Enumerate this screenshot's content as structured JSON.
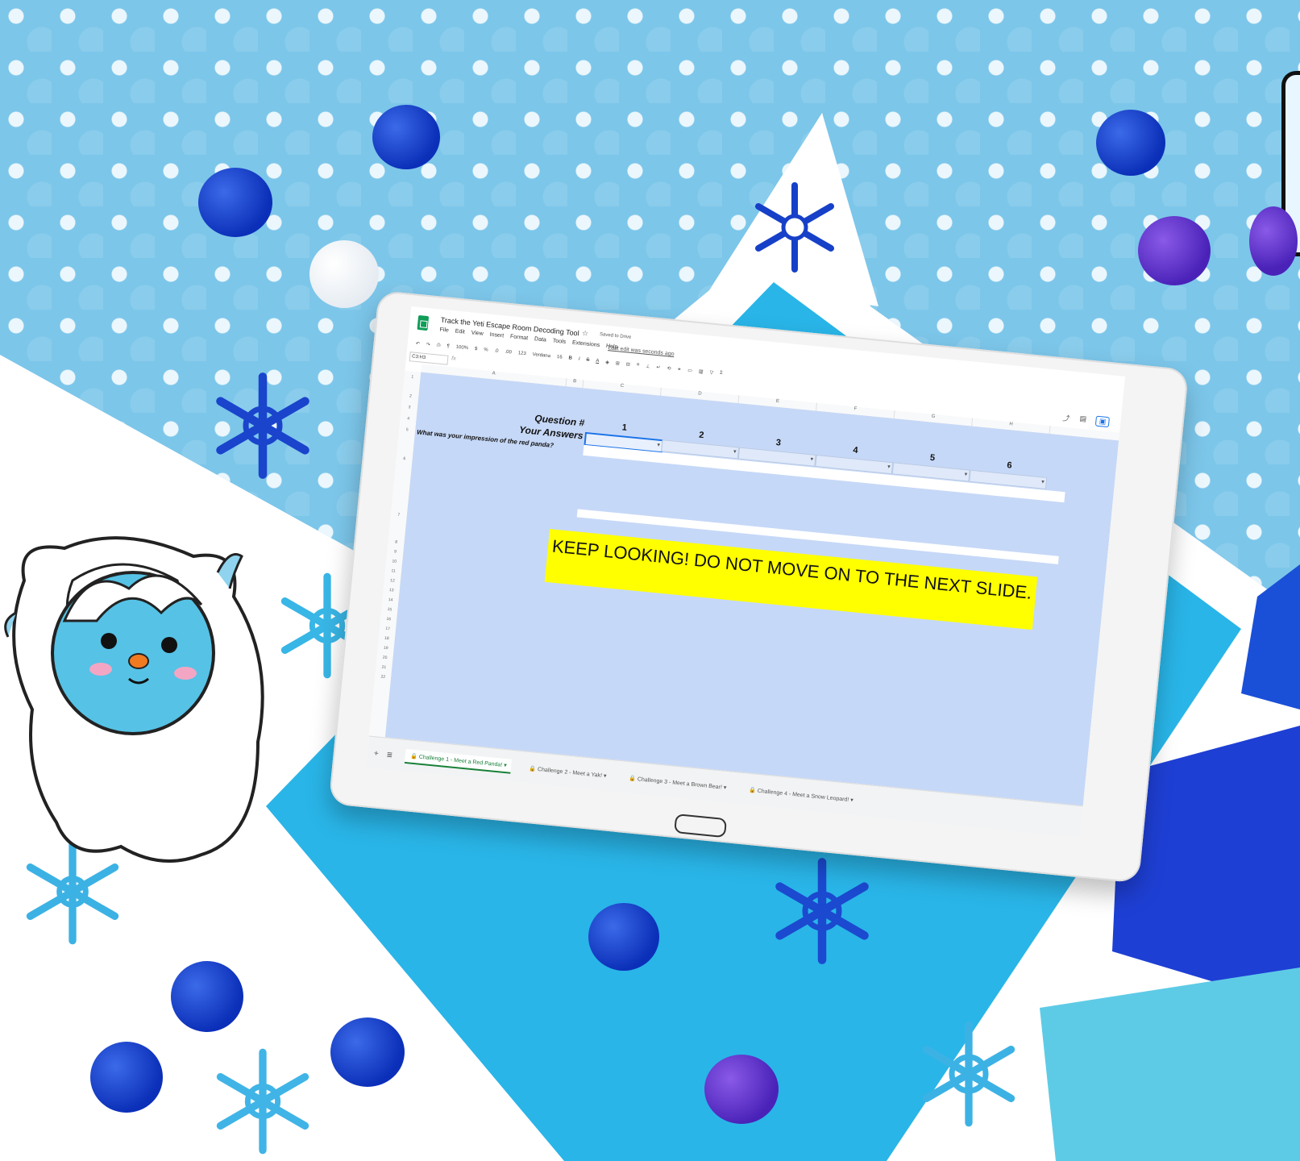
{
  "sheet": {
    "title": "Track the Yeti Escape Room Decoding Tool",
    "saved_status": "Saved to Drive",
    "last_edit": "Last edit was seconds ago",
    "menu": [
      "File",
      "Edit",
      "View",
      "Insert",
      "Format",
      "Data",
      "Tools",
      "Extensions",
      "Help"
    ],
    "toolbar": {
      "zoom": "100%",
      "currency": "$",
      "percent": "%",
      "decrease_decimal": ".0",
      "increase_decimal": ".00",
      "number_format": "123",
      "font": "Verdana",
      "font_size": "16",
      "bold": "B",
      "italic": "I",
      "strike": "S",
      "text_color": "A",
      "functions": "Σ"
    },
    "name_box": "C3:H3",
    "fx": "fx",
    "columns": [
      "A",
      "B",
      "C",
      "D",
      "E",
      "F",
      "G",
      "H"
    ],
    "rows": [
      "1",
      "2",
      "3",
      "4",
      "5",
      "6",
      "7",
      "8",
      "9",
      "10",
      "11",
      "12",
      "13",
      "14",
      "15",
      "16",
      "17",
      "18",
      "19",
      "20",
      "21",
      "22"
    ],
    "question_label": "Question #",
    "answers_label": "Your Answers",
    "question_numbers": [
      "1",
      "2",
      "3",
      "4",
      "5",
      "6"
    ],
    "impression_label": "What was your impression of the red panda?",
    "banner": "KEEP LOOKING! DO NOT MOVE ON TO THE NEXT SLIDE.",
    "tabs": [
      {
        "label": "Challenge 1 - Meet a Red Panda!",
        "active": true
      },
      {
        "label": "Challenge 2 - Meet a Yak!",
        "active": false
      },
      {
        "label": "Challenge 3 - Meet a Brown Bear!",
        "active": false
      },
      {
        "label": "Challenge 4 - Meet a Snow Leopard!",
        "active": false
      }
    ]
  },
  "colors": {
    "grid_fill": "#c6d8f7",
    "banner_fill": "#ffff00",
    "active_tab": "#188038",
    "background_cyan": "#29b5e8"
  }
}
